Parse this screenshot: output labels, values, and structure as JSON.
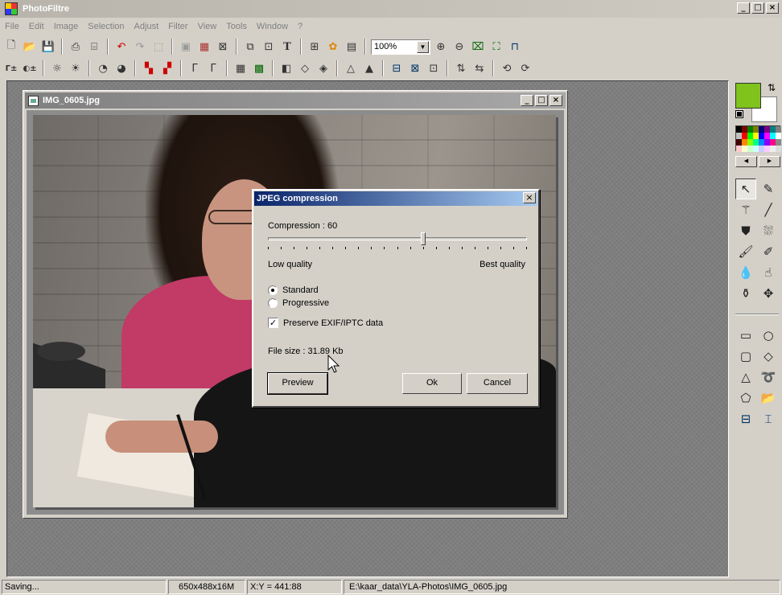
{
  "app": {
    "title": "PhotoFiltre"
  },
  "window_buttons": {
    "minimize": "_",
    "maximize": "□",
    "close": "×"
  },
  "menu": [
    "File",
    "Edit",
    "Image",
    "Selection",
    "Adjust",
    "Filter",
    "View",
    "Tools",
    "Window",
    "?"
  ],
  "toolbar1": {
    "zoom_value": "100%",
    "icons": [
      "new-icon",
      "open-icon",
      "save-icon",
      "print-icon",
      "scan-icon",
      "undo-icon",
      "redo-icon",
      "crop-selection-icon",
      "image-size-icon",
      "palette-icon",
      "trash-icon",
      "clipboard-icon",
      "paste-icon",
      "text-icon",
      "layers-icon",
      "plugin-icon",
      "window-icon",
      "zoom-in-icon",
      "zoom-out-icon",
      "fit-icon",
      "fullscreen-icon",
      "presentation-icon"
    ]
  },
  "toolbar2": {
    "icons": [
      "auto-levels-icon",
      "auto-contrast-icon",
      "brightness-minus-icon",
      "brightness-plus-icon",
      "contrast-minus-icon",
      "contrast-plus-icon",
      "saturation-minus-icon",
      "saturation-plus-icon",
      "gamma-minus-icon",
      "gamma-plus-icon",
      "grid-icon",
      "mosaic-icon",
      "grayscale-icon",
      "blur-icon",
      "sharpen-icon",
      "soften-icon",
      "emboss-icon",
      "effect1-icon",
      "effect2-icon",
      "effect3-icon",
      "flip-icon",
      "mirror-icon",
      "rotate-left-icon",
      "rotate-right-icon"
    ]
  },
  "image_window": {
    "title": "IMG_0605.jpg"
  },
  "dialog": {
    "title": "JPEG compression",
    "close": "×",
    "compression_label": "Compression : 60",
    "compression_value": 60,
    "compression_max": 100,
    "low_quality": "Low quality",
    "best_quality": "Best quality",
    "mode_standard": "Standard",
    "mode_progressive": "Progressive",
    "selected_mode": "Standard",
    "preserve_exif": "Preserve EXIF/IPTC data",
    "preserve_checked": true,
    "file_size": "File size : 31.89 Kb",
    "buttons": {
      "preview": "Preview",
      "ok": "Ok",
      "cancel": "Cancel"
    }
  },
  "colors": {
    "foreground": "#7fc31c",
    "background": "#ffffff",
    "title_active": "#0a246a"
  },
  "status": {
    "message": "Saving...",
    "dimensions": "650x488x16M",
    "coords": "X:Y = 441:88",
    "path": "E:\\kaar_data\\YLA-Photos\\IMG_0605.jpg"
  }
}
